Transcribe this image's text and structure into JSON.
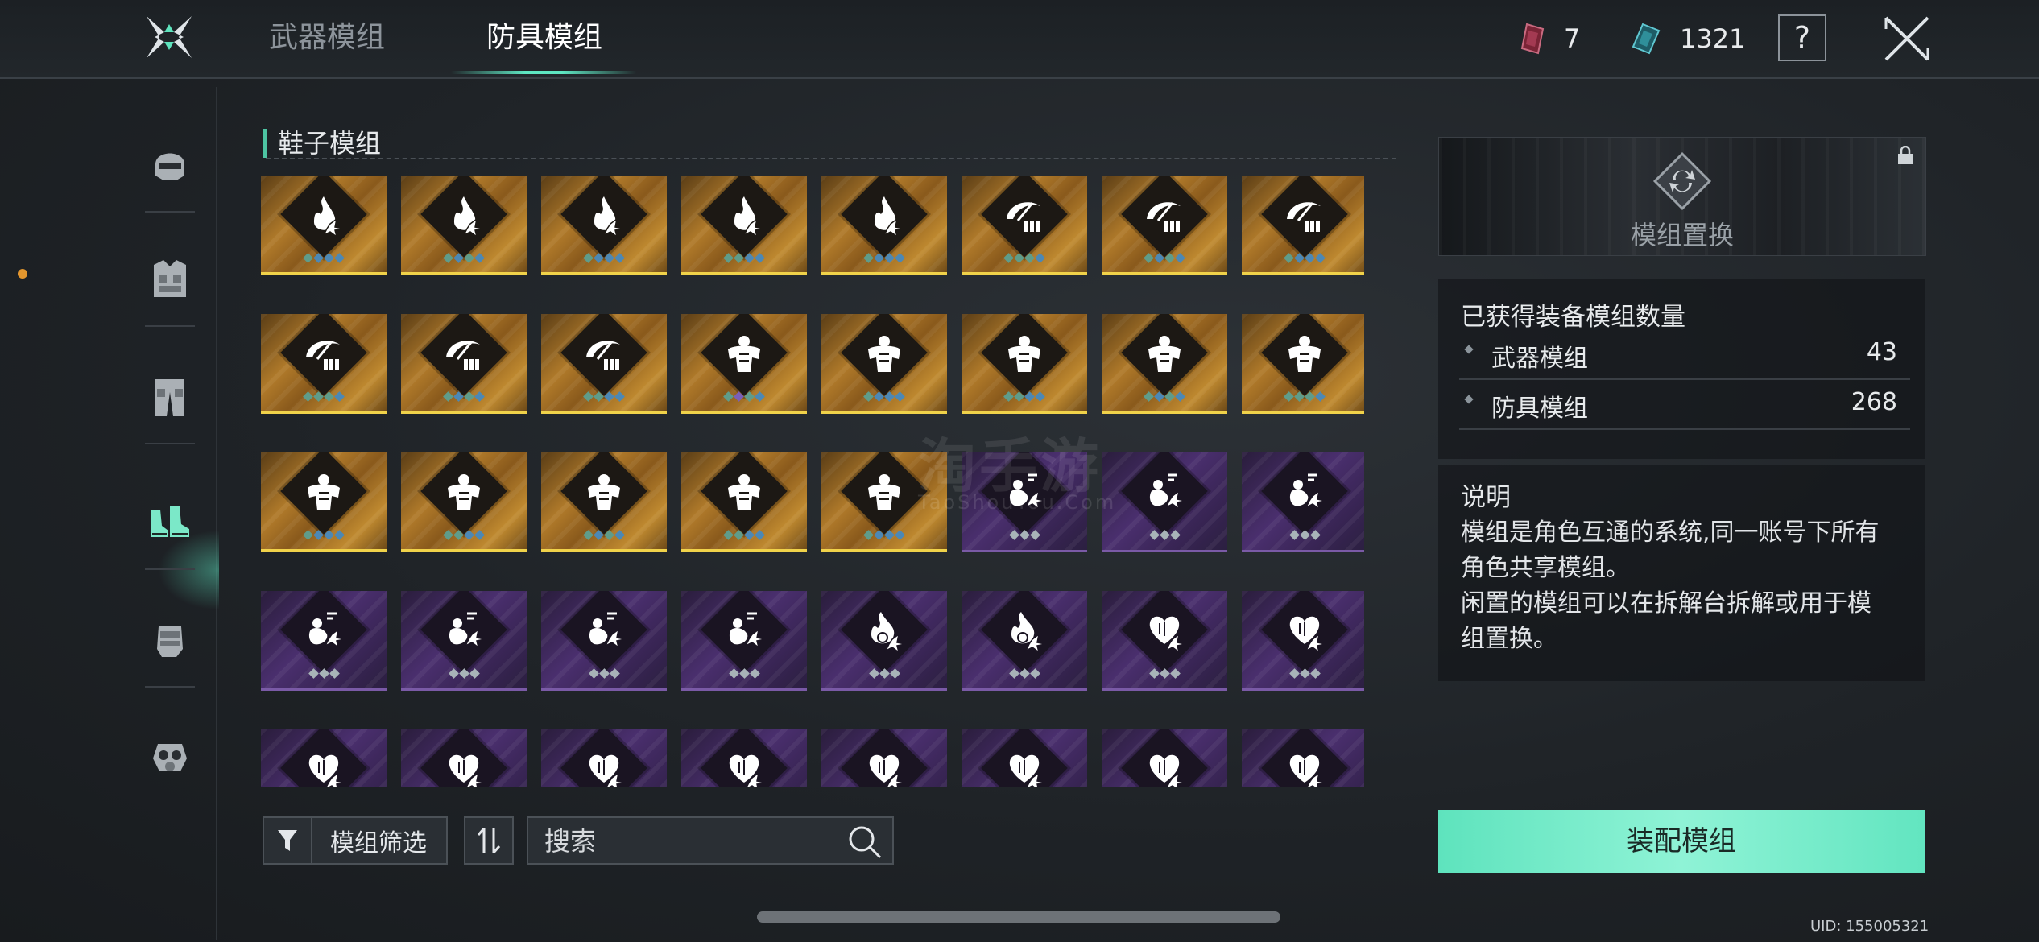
{
  "header": {
    "tabs": [
      {
        "label": "武器模组",
        "active": false
      },
      {
        "label": "防具模组",
        "active": true
      }
    ],
    "currencies": [
      {
        "icon": "red-chip-icon",
        "value": "7"
      },
      {
        "icon": "teal-chip-icon",
        "value": "1321"
      }
    ],
    "help_label": "?"
  },
  "sidebar": {
    "items": [
      {
        "icon": "helmet-icon",
        "active": false
      },
      {
        "icon": "armor-vest-icon",
        "active": false
      },
      {
        "icon": "pants-icon",
        "active": false
      },
      {
        "icon": "boots-icon",
        "active": true
      },
      {
        "icon": "glove-icon",
        "active": false
      },
      {
        "icon": "gas-mask-icon",
        "active": false
      }
    ]
  },
  "section": {
    "title": "鞋子模组"
  },
  "mods": [
    {
      "rarity": "gold",
      "icon": "flame-icon",
      "pips": [
        "g",
        "b",
        "b",
        "b"
      ]
    },
    {
      "rarity": "gold",
      "icon": "flame-icon",
      "pips": [
        "g",
        "b",
        "g",
        "b"
      ]
    },
    {
      "rarity": "gold",
      "icon": "flame-icon",
      "pips": [
        "g",
        "b",
        "b",
        "b"
      ]
    },
    {
      "rarity": "gold",
      "icon": "flame-icon",
      "pips": [
        "g",
        "g",
        "b",
        "b"
      ]
    },
    {
      "rarity": "gold",
      "icon": "flame-icon",
      "pips": [
        "g",
        "b",
        "b",
        "b"
      ]
    },
    {
      "rarity": "gold",
      "icon": "scythe-ammo-icon",
      "pips": [
        "g",
        "g",
        "g",
        "b"
      ]
    },
    {
      "rarity": "gold",
      "icon": "scythe-ammo-icon",
      "pips": [
        "g",
        "b",
        "g",
        "b"
      ]
    },
    {
      "rarity": "gold",
      "icon": "scythe-ammo-icon",
      "pips": [
        "g",
        "b",
        "b",
        "b"
      ]
    },
    {
      "rarity": "gold",
      "icon": "scythe-ammo-icon",
      "pips": [
        "g",
        "g",
        "g",
        "b"
      ]
    },
    {
      "rarity": "gold",
      "icon": "scythe-ammo-icon",
      "pips": [
        "g",
        "b",
        "g",
        "b"
      ]
    },
    {
      "rarity": "gold",
      "icon": "scythe-ammo-icon",
      "pips": [
        "g",
        "g",
        "b",
        "b"
      ]
    },
    {
      "rarity": "gold",
      "icon": "muscle-icon",
      "pips": [
        "g",
        "v",
        "g",
        "b"
      ]
    },
    {
      "rarity": "gold",
      "icon": "muscle-icon",
      "pips": [
        "g",
        "b",
        "b",
        "b"
      ]
    },
    {
      "rarity": "gold",
      "icon": "muscle-icon",
      "pips": [
        "g",
        "g",
        "b",
        "b"
      ]
    },
    {
      "rarity": "gold",
      "icon": "muscle-icon",
      "pips": [
        "g",
        "b",
        "g",
        "b"
      ]
    },
    {
      "rarity": "gold",
      "icon": "muscle-icon",
      "pips": [
        "g",
        "g",
        "g",
        "b"
      ]
    },
    {
      "rarity": "gold",
      "icon": "muscle-icon",
      "pips": [
        "g",
        "b",
        "b",
        "b"
      ]
    },
    {
      "rarity": "gold",
      "icon": "muscle-icon",
      "pips": [
        "g",
        "g",
        "b",
        "b"
      ]
    },
    {
      "rarity": "gold",
      "icon": "muscle-icon",
      "pips": [
        "g",
        "b",
        "g",
        "b"
      ]
    },
    {
      "rarity": "gold",
      "icon": "muscle-icon",
      "pips": [
        "g",
        "g",
        "b",
        "b"
      ]
    },
    {
      "rarity": "gold",
      "icon": "muscle-icon",
      "pips": [
        "g",
        "b",
        "b",
        "b"
      ]
    },
    {
      "rarity": "purple",
      "icon": "crouch-figure-icon",
      "pips": [
        "w",
        "w",
        "w"
      ]
    },
    {
      "rarity": "purple",
      "icon": "crouch-figure-icon",
      "pips": [
        "w",
        "w",
        "w"
      ]
    },
    {
      "rarity": "purple",
      "icon": "crouch-figure-icon",
      "pips": [
        "w",
        "w",
        "w"
      ]
    },
    {
      "rarity": "purple",
      "icon": "crouch-figure-icon",
      "pips": [
        "w",
        "w",
        "w"
      ]
    },
    {
      "rarity": "purple",
      "icon": "crouch-figure-icon",
      "pips": [
        "w",
        "w",
        "w"
      ]
    },
    {
      "rarity": "purple",
      "icon": "crouch-figure-icon",
      "pips": [
        "w",
        "w",
        "w"
      ]
    },
    {
      "rarity": "purple",
      "icon": "crouch-figure-icon",
      "pips": [
        "w",
        "w",
        "w"
      ]
    },
    {
      "rarity": "purple",
      "icon": "flame-vortex-icon",
      "pips": [
        "w",
        "w",
        "w"
      ]
    },
    {
      "rarity": "purple",
      "icon": "flame-vortex-icon",
      "pips": [
        "w",
        "w",
        "w"
      ]
    },
    {
      "rarity": "purple",
      "icon": "heart-icon",
      "pips": [
        "w",
        "w",
        "w"
      ]
    },
    {
      "rarity": "purple",
      "icon": "heart-icon",
      "pips": [
        "w",
        "w",
        "w"
      ]
    },
    {
      "rarity": "purple",
      "icon": "heart-icon",
      "pips": [
        "w",
        "w",
        "w"
      ]
    },
    {
      "rarity": "purple",
      "icon": "heart-icon",
      "pips": [
        "w",
        "w",
        "w"
      ]
    },
    {
      "rarity": "purple",
      "icon": "heart-icon",
      "pips": [
        "w",
        "w",
        "w"
      ]
    },
    {
      "rarity": "purple",
      "icon": "heart-icon",
      "pips": [
        "w",
        "w",
        "w"
      ]
    },
    {
      "rarity": "purple",
      "icon": "heart-icon",
      "pips": [
        "w",
        "w",
        "w"
      ]
    },
    {
      "rarity": "purple",
      "icon": "heart-icon",
      "pips": [
        "w",
        "w",
        "w"
      ]
    },
    {
      "rarity": "purple",
      "icon": "heart-icon",
      "pips": [
        "w",
        "w",
        "w"
      ]
    },
    {
      "rarity": "purple",
      "icon": "heart-icon",
      "pips": [
        "w",
        "w",
        "w"
      ]
    }
  ],
  "toolbar": {
    "filter_label": "模组筛选",
    "sort_icon": "sort-icon",
    "search_placeholder": "搜索"
  },
  "preview": {
    "label": "模组置换"
  },
  "stats": {
    "title": "已获得装备模组数量",
    "rows": [
      {
        "label": "武器模组",
        "value": "43"
      },
      {
        "label": "防具模组",
        "value": "268"
      }
    ]
  },
  "description": {
    "title": "说明",
    "text": "模组是角色互通的系统,同一账号下所有\n角色共享模组。\n闲置的模组可以在拆解台拆解或用于模\n组置换。"
  },
  "equip_label": "装配模组",
  "uid": "UID: 155005321",
  "watermark": {
    "main": "淘手游",
    "sub": "TaoShouYou.Com"
  },
  "colors": {
    "accent": "#5ee3bd",
    "gold": "#f0d24a",
    "purple": "#4a2f6e",
    "notify": "#e3962e"
  }
}
